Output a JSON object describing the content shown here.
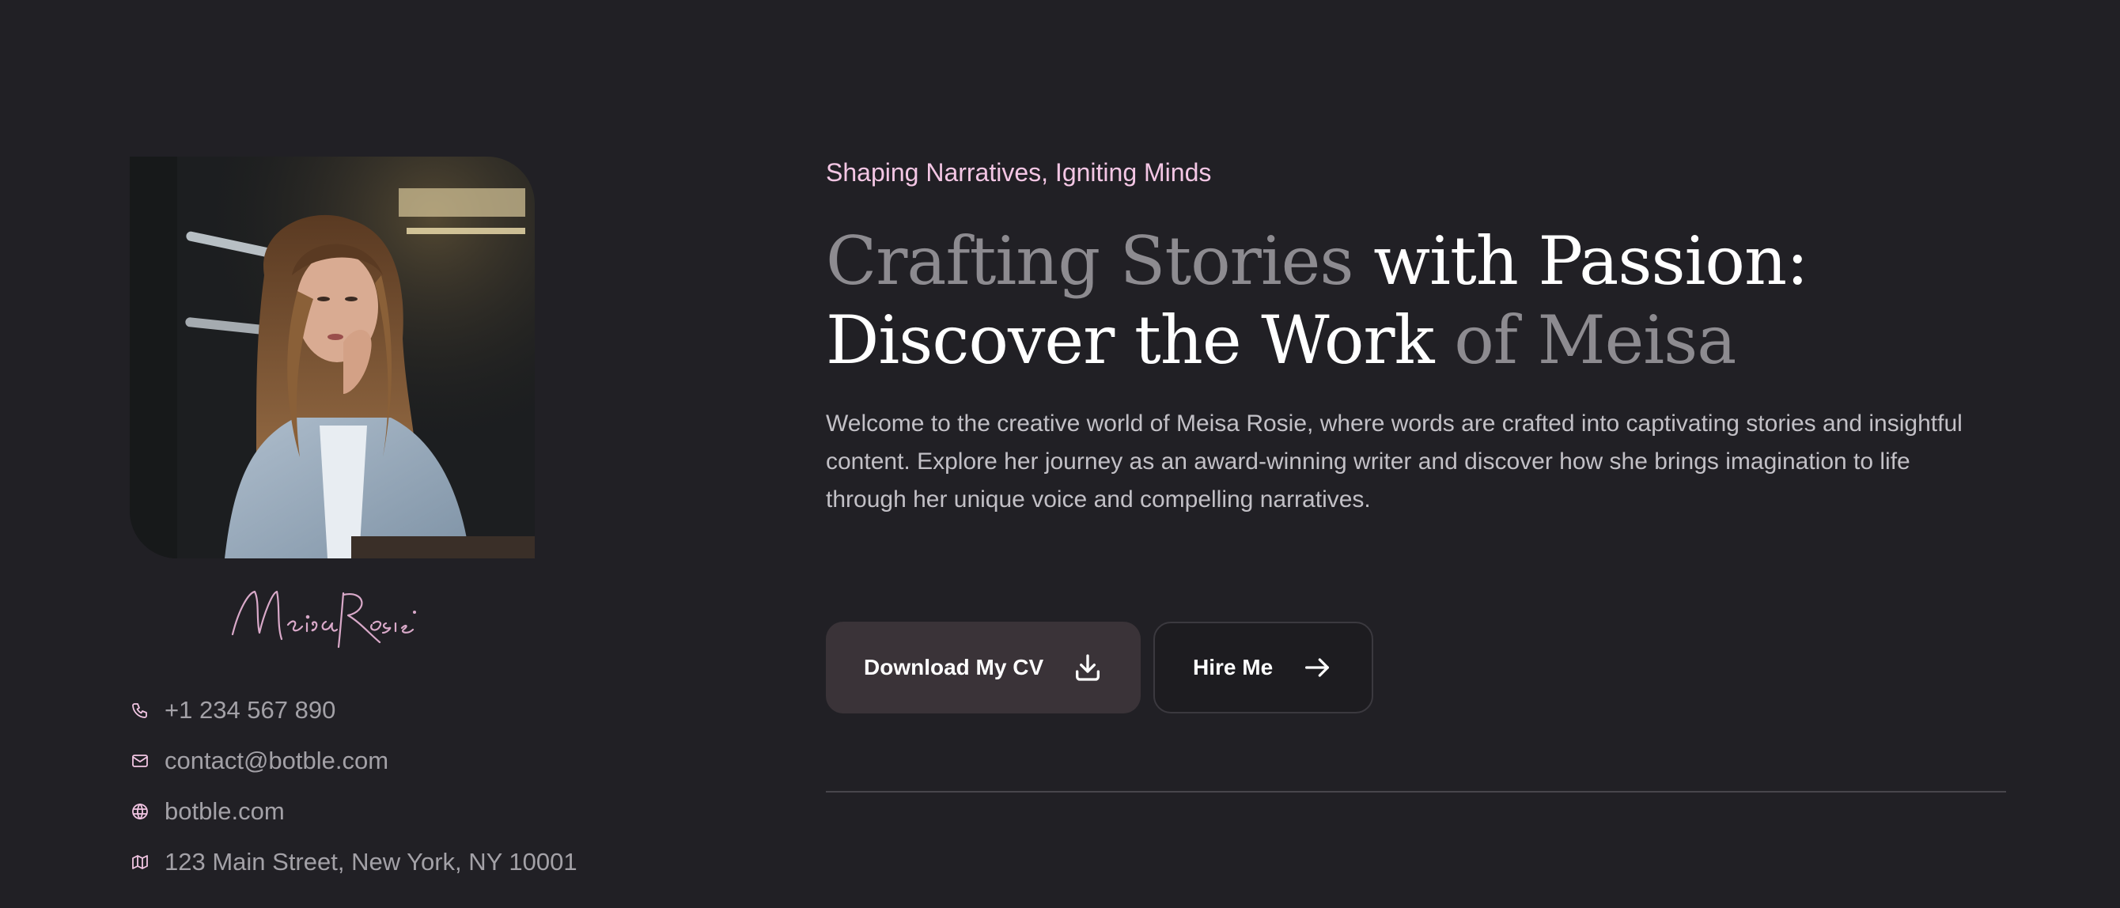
{
  "hero": {
    "tagline": "Shaping Narratives, Igniting Minds",
    "headline": {
      "part1_muted": "Crafting Stories",
      "part2": " with Passion:",
      "part3": "Discover the Work",
      "part4_muted": " of Meisa"
    },
    "intro": "Welcome to the creative world of Meisa Rosie, where words are crafted into captivating stories and insightful content. Explore her journey as an award-winning writer and discover how she brings imagination to life through her unique voice and compelling narratives.",
    "buttons": {
      "download_cv": "Download My CV",
      "hire_me": "Hire Me"
    }
  },
  "profile": {
    "signature_text": "MeisaRosie",
    "contacts": [
      {
        "icon": "phone-icon",
        "value": "+1 234 567 890"
      },
      {
        "icon": "mail-icon",
        "value": "contact@botble.com"
      },
      {
        "icon": "globe-icon",
        "value": "botble.com"
      },
      {
        "icon": "map-icon",
        "value": "123 Main Street, New York, NY 10001"
      }
    ]
  },
  "colors": {
    "background": "#212025",
    "accent_pink": "#f3c6e4",
    "muted_heading": "#8d8b90",
    "button_primary": "#3a3338"
  }
}
